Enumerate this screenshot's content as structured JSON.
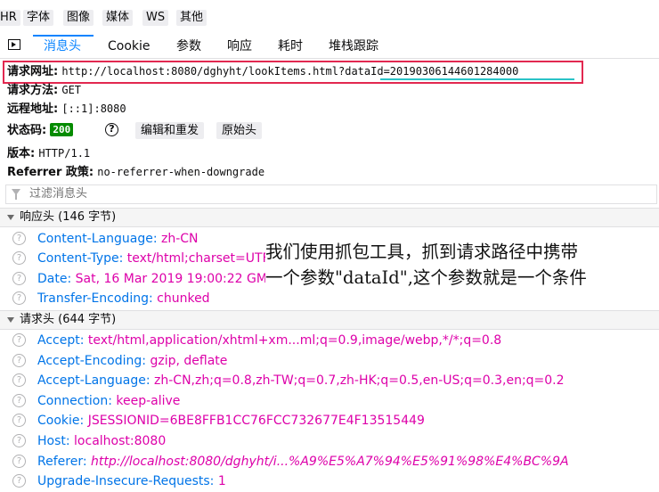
{
  "filter_buttons": [
    "HR",
    "字体",
    "图像",
    "媒体",
    "WS",
    "其他"
  ],
  "tabs": [
    "消息头",
    "Cookie",
    "参数",
    "响应",
    "耗时",
    "堆栈跟踪"
  ],
  "summary": {
    "request_url_label": "请求网址:",
    "request_url": "http://localhost:8080/dghyht/lookItems.html?dataId=20190306144601284000",
    "method_label": "请求方法:",
    "method": "GET",
    "remote_label": "远程地址:",
    "remote": "[::1]:8080",
    "status_label": "状态码:",
    "status": "200",
    "edit_resend": "编辑和重发",
    "raw_headers": "原始头",
    "version_label": "版本:",
    "version": "HTTP/1.1",
    "referrer_label": "Referrer 政策:",
    "referrer": "no-referrer-when-downgrade"
  },
  "filter_placeholder": "过滤消息头",
  "response_section": "响应头 (146 字节)",
  "response_headers": [
    {
      "name": "Content-Language:",
      "value": "zh-CN"
    },
    {
      "name": "Content-Type:",
      "value": "text/html;charset=UTF-8"
    },
    {
      "name": "Date:",
      "value": "Sat, 16 Mar 2019 19:00:22 GMT"
    },
    {
      "name": "Transfer-Encoding:",
      "value": "chunked"
    }
  ],
  "request_section": "请求头 (644 字节)",
  "request_headers": [
    {
      "name": "Accept:",
      "value": "text/html,application/xhtml+xm...ml;q=0.9,image/webp,*/*;q=0.8"
    },
    {
      "name": "Accept-Encoding:",
      "value": "gzip, deflate"
    },
    {
      "name": "Accept-Language:",
      "value": "zh-CN,zh;q=0.8,zh-TW;q=0.7,zh-HK;q=0.5,en-US;q=0.3,en;q=0.2"
    },
    {
      "name": "Connection:",
      "value": "keep-alive"
    },
    {
      "name": "Cookie:",
      "value": "JSESSIONID=6BE8FFB1CC76FCC732677E4F13515449"
    },
    {
      "name": "Host:",
      "value": "localhost:8080"
    },
    {
      "name": "Referer:",
      "value": "http://localhost:8080/dghyht/i...%A9%E5%A7%94%E5%91%98%E4%BC%9A"
    },
    {
      "name": "Upgrade-Insecure-Requests:",
      "value": "1"
    }
  ],
  "annotation": {
    "line1": "我们使用抓包工具，抓到请求路径中携带",
    "line2": "一个参数\"dataId\",这个参数就是一个条件"
  },
  "colors": {
    "accent": "#0a84ff",
    "header_name": "#0074e8",
    "header_value": "#dd00a9",
    "status_ok": "#058b00",
    "highlight_box": "#e22850",
    "underline": "#2ac3c7"
  },
  "icons": {
    "toggle": "panel-toggle-icon",
    "help": "help-icon",
    "filter": "filter-icon",
    "caret": "caret-down-icon",
    "info": "info-icon"
  }
}
